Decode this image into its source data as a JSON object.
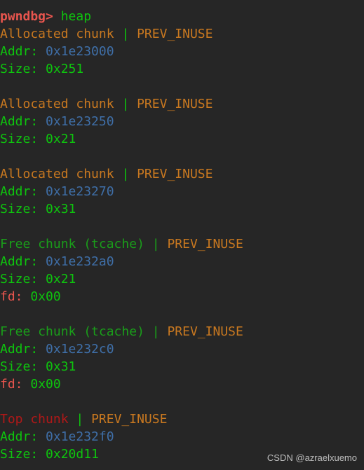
{
  "terminal": {
    "background_color": "#262626",
    "prompt": {
      "label": "pwndbg>",
      "command": "heap",
      "prompt_color": "#e8554e",
      "command_color": "#0ec40e"
    },
    "colors": {
      "green": "#0ec40e",
      "green_dim": "#1a9e1a",
      "orange": "#c87820",
      "blue": "#3f6fa8",
      "red": "#b01818",
      "salmon": "#e8554e"
    },
    "separator": "|",
    "flag": "PREV_INUSE",
    "labels": {
      "addr": "Addr:",
      "size": "Size:",
      "fd": "fd:"
    },
    "chunks": [
      {
        "title": "Allocated chunk",
        "title_color": "#c87820",
        "flag": "PREV_INUSE",
        "addr": "0x1e23000",
        "size": "0x251",
        "fd": null
      },
      {
        "title": "Allocated chunk",
        "title_color": "#c87820",
        "flag": "PREV_INUSE",
        "addr": "0x1e23250",
        "size": "0x21",
        "fd": null
      },
      {
        "title": "Allocated chunk",
        "title_color": "#c87820",
        "flag": "PREV_INUSE",
        "addr": "0x1e23270",
        "size": "0x31",
        "fd": null
      },
      {
        "title": "Free chunk (tcache)",
        "title_color": "#1a9e1a",
        "flag": "PREV_INUSE",
        "addr": "0x1e232a0",
        "size": "0x21",
        "fd": "0x00"
      },
      {
        "title": "Free chunk (tcache)",
        "title_color": "#1a9e1a",
        "flag": "PREV_INUSE",
        "addr": "0x1e232c0",
        "size": "0x31",
        "fd": "0x00"
      },
      {
        "title": "Top chunk",
        "title_color": "#b01818",
        "flag": "PREV_INUSE",
        "addr": "0x1e232f0",
        "size": "0x20d11",
        "fd": null
      }
    ]
  },
  "watermark": {
    "text": "CSDN @azraelxuemo"
  }
}
